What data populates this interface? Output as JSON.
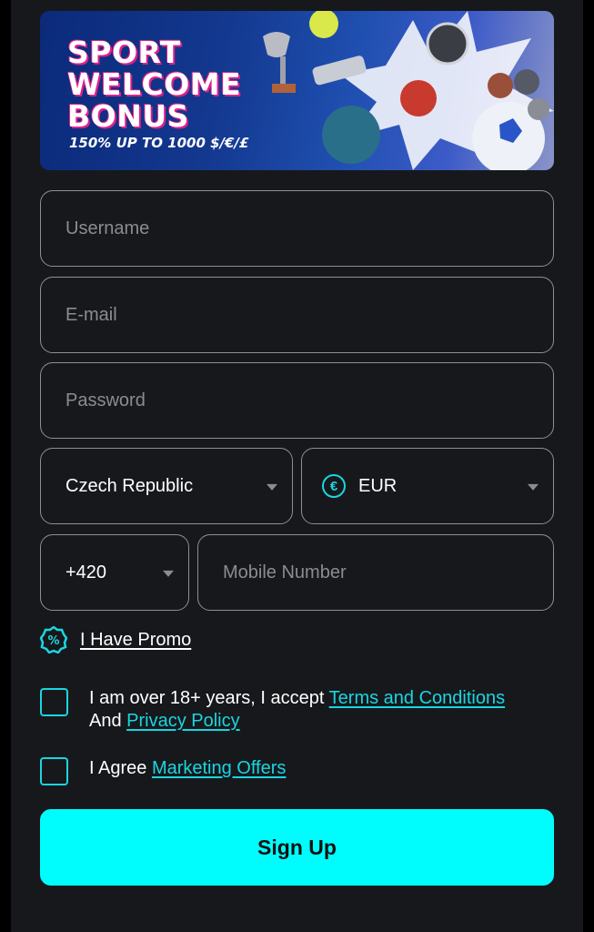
{
  "banner": {
    "title": "SPORT\nWELCOME\nBONUS",
    "subtitle": "150% UP TO 1000 $/€/£"
  },
  "form": {
    "username_placeholder": "Username",
    "email_placeholder": "E-mail",
    "password_placeholder": "Password",
    "country_value": "Czech Republic",
    "currency_value": "EUR",
    "currency_icon": "€",
    "phone_code_value": "+420",
    "mobile_placeholder": "Mobile Number"
  },
  "promo": {
    "label": "I Have Promo",
    "icon": "%"
  },
  "terms": {
    "text_before": "I am over 18+ years, I accept ",
    "terms_link": "Terms and Conditions",
    "text_and": "And ",
    "privacy_link": "Privacy Policy"
  },
  "marketing": {
    "text": "I Agree ",
    "link": "Marketing Offers"
  },
  "signup_label": "Sign Up",
  "colors": {
    "accent": "#19d6e0",
    "button": "#00fdfd",
    "panel": "#17181c",
    "border": "#8e8f94"
  }
}
